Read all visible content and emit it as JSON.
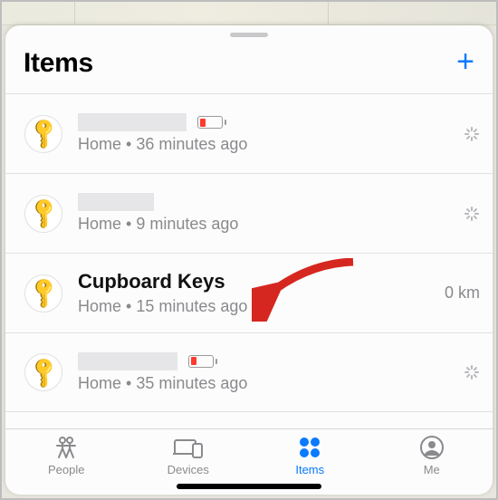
{
  "header": {
    "title": "Items",
    "add_label": "+"
  },
  "items": [
    {
      "name": "",
      "status": "Home • 36 minutes ago",
      "battery_low": true,
      "right": "spinner"
    },
    {
      "name": "",
      "status": "Home • 9 minutes ago",
      "battery_low": false,
      "right": "spinner"
    },
    {
      "name": "Cupboard Keys",
      "status": "Home • 15 minutes ago",
      "battery_low": false,
      "right": "distance",
      "distance": "0 km"
    },
    {
      "name": "",
      "status": "Home • 35 minutes ago",
      "battery_low": true,
      "right": "spinner"
    }
  ],
  "tabs": {
    "people": "People",
    "devices": "Devices",
    "items": "Items",
    "me": "Me",
    "active": "items"
  },
  "colors": {
    "accent": "#0a7aff",
    "battery_low": "#ff3b30"
  }
}
